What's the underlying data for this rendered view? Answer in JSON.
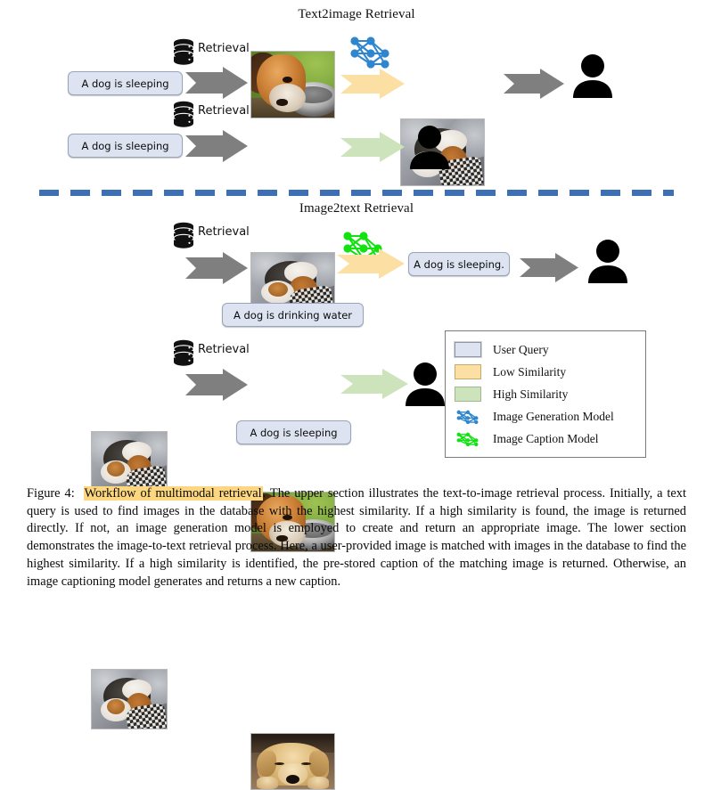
{
  "figure": {
    "sections": [
      {
        "title": "Text2image Retrieval"
      },
      {
        "title": "Image2text Retrieval"
      }
    ],
    "labels": {
      "retrieval": "Retrieval"
    },
    "text2image": {
      "row_high_not_found": {
        "query": "A dog is sleeping",
        "retrieval_label": "Retrieval",
        "db_image_alt": "beagle-drinking-water",
        "model_icon": "image-generation-model-icon",
        "result_image_alt": "sleeping-puppies",
        "arrow_similarity": "low"
      },
      "row_high_found": {
        "query": "A dog is sleeping",
        "retrieval_label": "Retrieval",
        "db_image_alt": "sleeping-puppies",
        "arrow_similarity": "high"
      }
    },
    "image2text": {
      "row_low": {
        "query_image_alt": "sleeping-puppies",
        "retrieval_label": "Retrieval",
        "db_image_alt": "beagle-drinking-water",
        "db_caption": "A dog is drinking water",
        "model_icon": "image-caption-model-icon",
        "result_text": "A dog is sleeping.",
        "arrow_similarity": "low"
      },
      "row_high": {
        "query_image_alt": "sleeping-puppies",
        "retrieval_label": "Retrieval",
        "db_image_alt": "sleeping-golden-retriever",
        "db_caption": "A dog is sleeping",
        "arrow_similarity": "high"
      }
    },
    "legend": {
      "items": [
        {
          "label": "User Query",
          "type": "swatch",
          "color": "#dde3f0"
        },
        {
          "label": "Low Similarity",
          "type": "swatch",
          "color": "#fbdfa3"
        },
        {
          "label": "High Similarity",
          "type": "swatch",
          "color": "#cde3bc"
        },
        {
          "label": "Image Generation Model",
          "type": "network",
          "color": "#2f86cf"
        },
        {
          "label": "Image Caption Model",
          "type": "network",
          "color": "#12e212"
        }
      ]
    },
    "colors": {
      "arrow_gray": "#7f7f7f",
      "arrow_low_similarity": "#fbdfa3",
      "arrow_high_similarity": "#cde3bc",
      "divider_blue": "#3d6fb4",
      "query_box_fill": "#dde3f0",
      "generation_model_blue": "#2f86cf",
      "caption_model_green": "#12e212",
      "highlight_yellow": "#fcd77f"
    }
  },
  "caption": {
    "prefix": "Figure 4:",
    "highlight": "Workflow of multimodal retrieval",
    "body": ". The upper section illustrates the text-to-image retrieval process. Initially, a text query is used to find images in the database with the highest similarity. If a high similarity is found, the image is returned directly. If not, an image generation model is employed to create and return an appropriate image. The lower section demonstrates the image-to-text retrieval process. Here, a user-provided image is matched with images in the database to find the highest similarity. If a high similarity is identified, the pre-stored caption of the matching image is returned. Otherwise, an image captioning model generates and returns a new caption."
  }
}
